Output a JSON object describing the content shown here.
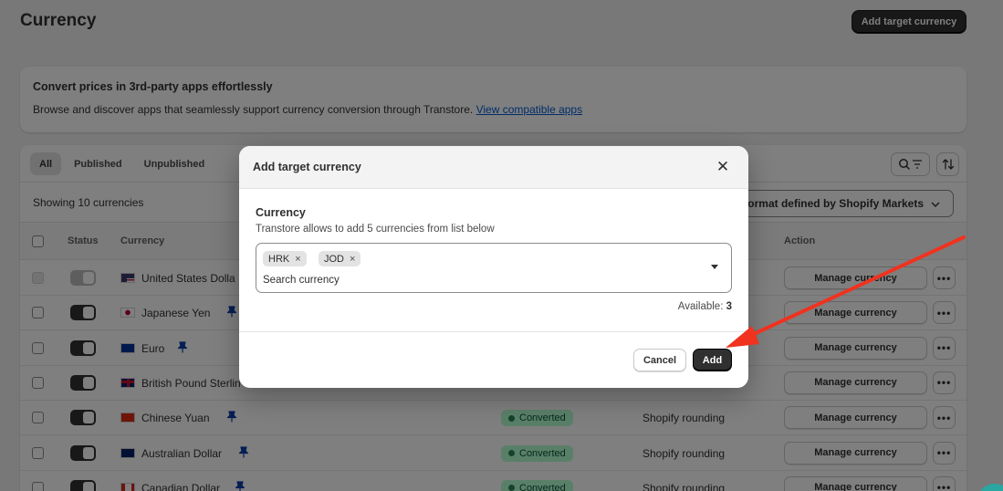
{
  "page": {
    "title": "Currency",
    "add_button": "Add target currency"
  },
  "banner": {
    "title": "Convert prices in 3rd-party apps effortlessly",
    "text": "Browse and discover apps that seamlessly support currency conversion through Transtore.",
    "link": "View compatible apps"
  },
  "tabs": [
    "All",
    "Published",
    "Unpublished"
  ],
  "table": {
    "showing": "Showing 10 currencies",
    "market_select": "ormat defined by Shopify Markets",
    "headers": {
      "status": "Status",
      "currency": "Currency",
      "action": "Action"
    },
    "manage_label": "Manage currency",
    "more_label": "•••",
    "rows": [
      {
        "name": "United States Dolla",
        "flag": "us",
        "pinned": false,
        "status": "",
        "rounding": "",
        "disabled": true
      },
      {
        "name": "Japanese Yen",
        "flag": "jp",
        "pinned": true,
        "status": "",
        "rounding": ""
      },
      {
        "name": "Euro",
        "flag": "eu",
        "pinned": true,
        "status": "",
        "rounding": ""
      },
      {
        "name": "British Pound Sterlin",
        "flag": "gb",
        "pinned": false,
        "status": "",
        "rounding": ""
      },
      {
        "name": "Chinese Yuan",
        "flag": "cn",
        "pinned": true,
        "status": "Converted",
        "rounding": "Shopify rounding"
      },
      {
        "name": "Australian Dollar",
        "flag": "au",
        "pinned": true,
        "status": "Converted",
        "rounding": "Shopify rounding"
      },
      {
        "name": "Canadian Dollar",
        "flag": "ca",
        "pinned": true,
        "status": "Converted",
        "rounding": "Shopify rounding"
      }
    ]
  },
  "modal": {
    "title": "Add target currency",
    "close": "✕",
    "field_label": "Currency",
    "field_help": "Transtore allows to add 5 currencies from list below",
    "chips": [
      {
        "label": "HRK",
        "remove": "×"
      },
      {
        "label": "JOD",
        "remove": "×"
      }
    ],
    "search_placeholder": "Search currency",
    "available_label": "Available:",
    "available_count": "3",
    "cancel": "Cancel",
    "add": "Add"
  },
  "colors": {
    "primary": "#303030",
    "link": "#005bd3",
    "badge_bg": "#b4fed2",
    "badge_dot": "#29845a",
    "annotation_arrow": "#f0321e"
  },
  "icons": {
    "search": "search-icon",
    "filter": "filter-icon",
    "sort": "sort-icon",
    "pin": "pin-icon",
    "chevron": "chevron-down-icon"
  }
}
